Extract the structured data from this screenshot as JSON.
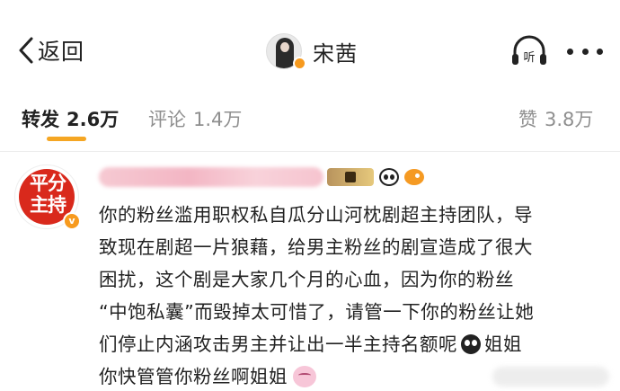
{
  "nav": {
    "back_label": "返回",
    "title": "宋茜",
    "back_icon": "chevron-left-icon",
    "listen_icon": "headphones-icon",
    "more_icon": "more-horizontal-icon"
  },
  "tabs": {
    "forward_label": "转发",
    "forward_count": "2.6万",
    "comment_label": "评论",
    "comment_count": "1.4万",
    "like_label": "赞",
    "like_count": "3.8万",
    "active_color": "#f5a623"
  },
  "comment": {
    "avatar_text": "平分主持",
    "verified_mark": "v",
    "lines": [
      "你的粉丝滥用职权私自瓜分山河枕剧超主持团队，导",
      "致现在剧超一片狼藉，给男主粉丝的剧宣造成了很大",
      "困扰，这个剧是大家几个月的心血，因为你的粉丝",
      "“中饱私囊”而毁掉太可惜了，请管一下你的粉丝让她",
      "们停止内涵攻击男主并让出一半主持名额呢"
    ],
    "line5_tail": "姐姐",
    "line6": "你快管管你粉丝啊姐姐"
  }
}
